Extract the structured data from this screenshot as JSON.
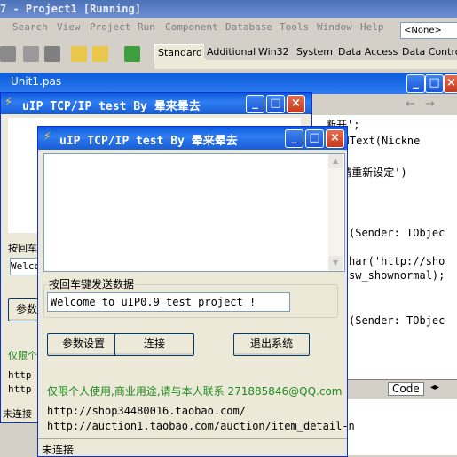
{
  "ide": {
    "title": "7 - Project1 [Running]",
    "menu": [
      "Search",
      "View",
      "Project",
      "Run",
      "Component",
      "Database",
      "Tools",
      "Window",
      "Help"
    ],
    "component_select": "<None>",
    "palette_tabs": [
      "Standard",
      "Additional",
      "Win32",
      "System",
      "Data Access",
      "Data Controls"
    ],
    "unit_tab": "Unit1.pas",
    "code_lines": [
      "断开';",
      "SendText(Nickne",
      "确,请重新设定')",
      "(Sender: TObjec",
      "har('http://sho",
      "sw_shownormal);",
      "(Sender: TObjec"
    ],
    "code_tab": "Code"
  },
  "back_window": {
    "title": "uIP TCP/IP test  By 晕来晕去",
    "label_partial": "按回车",
    "input_partial": "Welco",
    "button_partial": "参数",
    "green_partial": "仅限个人",
    "link1_partial": "http",
    "link2_partial": "http",
    "status_partial": "未连接"
  },
  "front_window": {
    "title": "uIP TCP/IP test  By 晕来晕去",
    "group_label": "按回车键发送数据",
    "message_input": "Welcome to uIP0.9 test project !",
    "buttons": {
      "settings": "参数设置",
      "connect": "连接",
      "exit": "退出系统"
    },
    "notice": "仅限个人使用,商业用途,请与本人联系  271885846@QQ.com",
    "links": [
      "http://shop34480016.taobao.com/",
      "http://auction1.taobao.com/auction/item_detail-n"
    ],
    "status": "未连接"
  },
  "colors": {
    "xp_blue": "#0a5bdc",
    "green_text": "#1e8c1e",
    "ide_title": "#4c72b8"
  }
}
